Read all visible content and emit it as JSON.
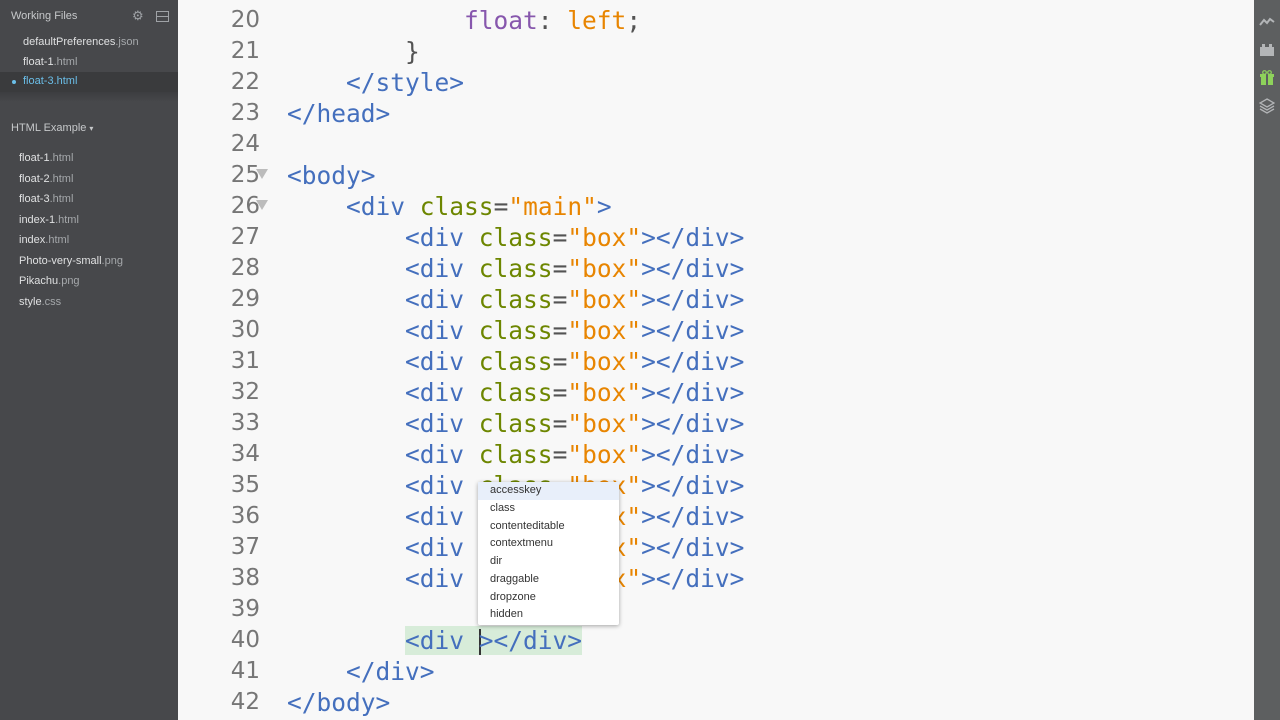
{
  "sidebar": {
    "working_files_title": "Working Files",
    "working_files": [
      {
        "name": "defaultPreferences",
        "ext": ".json"
      },
      {
        "name": "float-1",
        "ext": ".html"
      },
      {
        "name": "float-3",
        "ext": ".html"
      }
    ],
    "project_title": "HTML Example",
    "project_caret": "▾",
    "files": [
      {
        "name": "float-1",
        "ext": ".html"
      },
      {
        "name": "float-2",
        "ext": ".html"
      },
      {
        "name": "float-3",
        "ext": ".html"
      },
      {
        "name": "index-1",
        "ext": ".html"
      },
      {
        "name": "index",
        "ext": ".html"
      },
      {
        "name": "Photo-very-small",
        "ext": ".png"
      },
      {
        "name": "Pikachu",
        "ext": ".png"
      },
      {
        "name": "style",
        "ext": ".css"
      }
    ]
  },
  "editor": {
    "lines": [
      {
        "n": "20",
        "a": "            ",
        "b": "float",
        "c": ": ",
        "d": "left",
        "e": ";"
      },
      {
        "n": "21",
        "a": "        }"
      },
      {
        "n": "22",
        "a": "    ",
        "t": "</style>"
      },
      {
        "n": "23",
        "t": "</head>"
      },
      {
        "n": "24"
      },
      {
        "n": "25",
        "t": "<body>"
      },
      {
        "n": "26",
        "a": "    ",
        "t": "<div",
        "sp": " ",
        "attr": "class",
        "eq": "=",
        "str": "\"main\"",
        "close": ">"
      },
      {
        "n": "27",
        "a": "        ",
        "t": "<div",
        "sp": " ",
        "attr": "class",
        "eq": "=",
        "str": "\"box\"",
        "close": "></div>"
      },
      {
        "n": "28",
        "a": "        ",
        "t": "<div",
        "sp": " ",
        "attr": "class",
        "eq": "=",
        "str": "\"box\"",
        "close": "></div>"
      },
      {
        "n": "29",
        "a": "        ",
        "t": "<div",
        "sp": " ",
        "attr": "class",
        "eq": "=",
        "str": "\"box\"",
        "close": "></div>"
      },
      {
        "n": "30",
        "a": "        ",
        "t": "<div",
        "sp": " ",
        "attr": "class",
        "eq": "=",
        "str": "\"box\"",
        "close": "></div>"
      },
      {
        "n": "31",
        "a": "        ",
        "t": "<div",
        "sp": " ",
        "attr": "class",
        "eq": "=",
        "str": "\"box\"",
        "close": "></div>"
      },
      {
        "n": "32",
        "a": "        ",
        "t": "<div",
        "sp": " ",
        "attr": "class",
        "eq": "=",
        "str": "\"box\"",
        "close": "></div>"
      },
      {
        "n": "33",
        "a": "        ",
        "t": "<div",
        "sp": " ",
        "attr": "class",
        "eq": "=",
        "str": "\"box\"",
        "close": "></div>"
      },
      {
        "n": "34",
        "a": "        ",
        "t": "<div",
        "sp": " ",
        "attr": "class",
        "eq": "=",
        "str": "\"box\"",
        "close": "></div>"
      },
      {
        "n": "35",
        "a": "        ",
        "t": "<div",
        "sp": " ",
        "attr": "class",
        "eq": "=",
        "str": "\"box\"",
        "close": "></div>"
      },
      {
        "n": "36",
        "a": "        ",
        "t": "<div",
        "sp": " ",
        "attr": "class",
        "eq": "=",
        "str": "\"box\"",
        "close": "></div>"
      },
      {
        "n": "37",
        "a": "        ",
        "t": "<div",
        "sp": " ",
        "attr": "class",
        "eq": "=",
        "str": "\"box\"",
        "close": "></div>"
      },
      {
        "n": "38",
        "a": "        ",
        "t": "<div",
        "sp": " ",
        "attr": "class",
        "eq": "=",
        "str": "\"box\"",
        "close": "></div>"
      },
      {
        "n": "39"
      },
      {
        "n": "40",
        "a": "        ",
        "t": "<div",
        "sp": " ",
        "close": "></div>"
      },
      {
        "n": "41",
        "a": "    ",
        "t": "</div>"
      },
      {
        "n": "42",
        "t": "</body>"
      }
    ],
    "hints": [
      "accesskey",
      "class",
      "contenteditable",
      "contextmenu",
      "dir",
      "draggable",
      "dropzone",
      "hidden"
    ]
  },
  "icons": {
    "gear": "gear-icon",
    "split": "split-view-icon",
    "live_preview": "live-preview-icon",
    "extensions": "extension-manager-icon",
    "gift": "gift-icon",
    "layers": "layers-icon"
  },
  "colors": {
    "tag": "#446fbd",
    "attribute": "#6d8600",
    "string": "#e88501",
    "property": "#8757ad",
    "active_file": "#6bbfe9",
    "highlight": "#d7ecd9"
  }
}
